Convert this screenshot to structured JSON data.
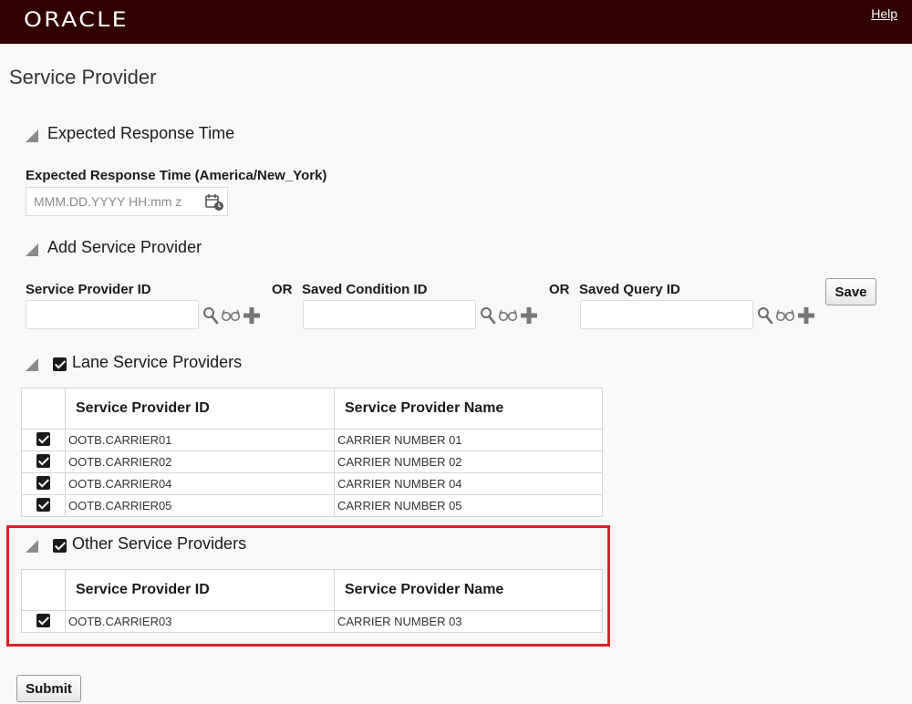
{
  "header": {
    "logo": "ORACLE",
    "help_label": "Help"
  },
  "page": {
    "title": "Service Provider"
  },
  "expected_response": {
    "section_title": "Expected Response Time",
    "field_label": "Expected Response Time (America/New_York)",
    "placeholder": "MMM.DD.YYYY HH:mm z",
    "value": ""
  },
  "add_provider": {
    "section_title": "Add Service Provider",
    "service_provider_id_label": "Service Provider ID",
    "or_label_1": "OR",
    "saved_condition_id_label": "Saved Condition ID",
    "or_label_2": "OR",
    "saved_query_id_label": "Saved Query ID",
    "save_label": "Save",
    "service_provider_id_value": "",
    "saved_condition_id_value": "",
    "saved_query_id_value": ""
  },
  "lane_providers": {
    "section_title": "Lane Service Providers",
    "checked": true,
    "columns": [
      "Service Provider ID",
      "Service Provider Name"
    ],
    "rows": [
      {
        "id": "OOTB.CARRIER01",
        "name": "CARRIER NUMBER 01",
        "checked": true
      },
      {
        "id": "OOTB.CARRIER02",
        "name": "CARRIER NUMBER 02",
        "checked": true
      },
      {
        "id": "OOTB.CARRIER04",
        "name": "CARRIER NUMBER 04",
        "checked": true
      },
      {
        "id": "OOTB.CARRIER05",
        "name": "CARRIER NUMBER 05",
        "checked": true
      }
    ]
  },
  "other_providers": {
    "section_title": "Other Service Providers",
    "checked": true,
    "columns": [
      "Service Provider ID",
      "Service Provider Name"
    ],
    "rows": [
      {
        "id": "OOTB.CARRIER03",
        "name": "CARRIER NUMBER 03",
        "checked": true
      }
    ]
  },
  "footer": {
    "submit_label": "Submit"
  },
  "colors": {
    "header_bg": "#310000",
    "highlight_border": "#e0202a",
    "page_bg": "#f9f8f7"
  }
}
